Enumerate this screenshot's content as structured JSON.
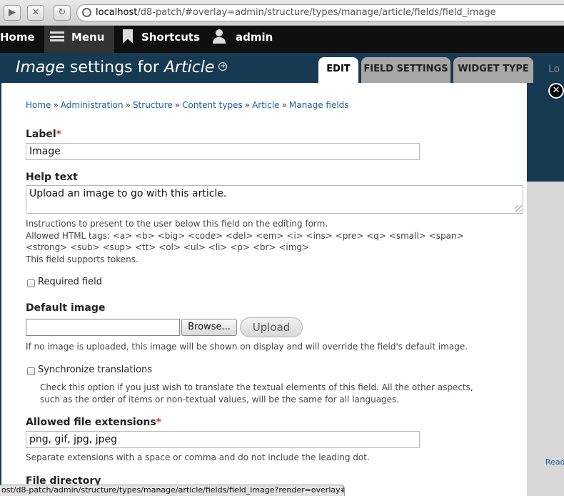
{
  "browser": {
    "url_host": "localhost",
    "url_path": "/d8-patch/#overlay=admin/structure/types/manage/article/fields/field_image",
    "status_url": "ost/d8-patch/admin/structure/types/manage/article/fields/field_image?render=overlay#"
  },
  "toolbar": {
    "home": "Home",
    "menu": "Menu",
    "shortcuts": "Shortcuts",
    "user": "admin"
  },
  "overlay": {
    "title_part1": "Image",
    "title_part2": " settings for ",
    "title_part3": "Article",
    "tabs": [
      {
        "label": "EDIT"
      },
      {
        "label": "FIELD SETTINGS"
      },
      {
        "label": "WIDGET TYPE"
      },
      {
        "label": "Lo"
      }
    ],
    "breadcrumb": [
      "Home",
      "Administration",
      "Structure",
      "Content types",
      "Article",
      "Manage fields"
    ],
    "breadcrumb_sep": "»",
    "peek_text": "Read"
  },
  "form": {
    "label_title": "Label",
    "required_mark": "*",
    "label_value": "Image",
    "help_title": "Help text",
    "help_value": "Upload an image to go with this article.",
    "help_desc_1": "Instructions to present to the user below this field on the editing form.",
    "help_desc_2": "Allowed HTML tags: <a> <b> <big> <code> <del> <em> <i> <ins> <pre> <q> <small> <span>",
    "help_desc_3": "<strong> <sub> <sup> <tt> <ol> <ul> <li> <p> <br> <img>",
    "help_desc_4": "This field supports tokens.",
    "required_label": "Required field",
    "default_image_title": "Default image",
    "browse_label": "Browse...",
    "upload_label": "Upload",
    "default_image_desc": "If no image is uploaded, this image will be shown on display and will override the field's default image.",
    "sync_label": "Synchronize translations",
    "sync_desc_1": "Check this option if you just wish to translate the textual elements of this field. All the other aspects,",
    "sync_desc_2": "such as the order of items or non-textual values, will be the same for all languages.",
    "ext_title": "Allowed file extensions",
    "ext_value": "png, gif, jpg, jpeg",
    "ext_desc": "Separate extensions with a space or comma and do not include the leading dot.",
    "dir_title": "File directory"
  }
}
